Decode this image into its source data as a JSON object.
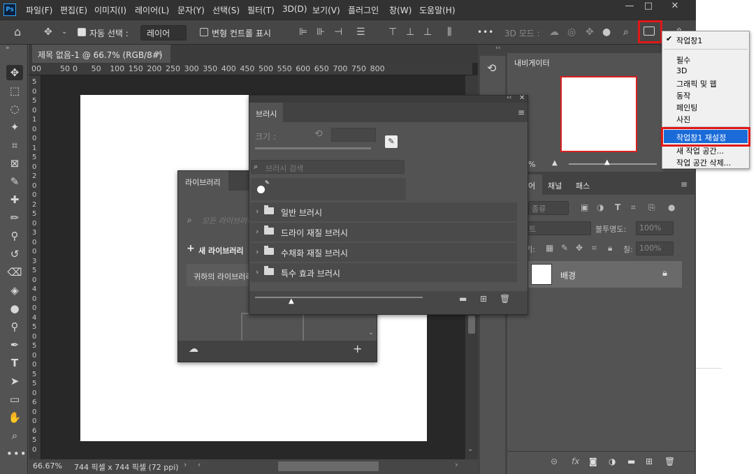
{
  "app": {
    "logo": "Ps"
  },
  "menu": [
    "파일(F)",
    "편집(E)",
    "이미지(I)",
    "레이어(L)",
    "문자(Y)",
    "선택(S)",
    "필터(T)",
    "3D(D)",
    "보기(V)",
    "플러그인",
    "창(W)",
    "도움말(H)"
  ],
  "window_controls": {
    "minimize": "—",
    "maximize": "□",
    "close": "✕"
  },
  "options": {
    "auto_select_label": "자동 선택 :",
    "auto_select_value": "레이어",
    "transform_label": "변형 컨트롤 표시",
    "more": "•••",
    "mode_3d_label": "3D 모드 :"
  },
  "document": {
    "tab_title": "제목 없음-1 @ 66.7% (RGB/8#)",
    "tab_close": "×",
    "zoom": "66.67%",
    "size_info": "744 픽셀 x 744 픽셀 (72 ppi)",
    "ruler_labels": [
      "00",
      "50",
      "0",
      "50",
      "100",
      "150",
      "200",
      "250",
      "300",
      "350",
      "400",
      "450",
      "500",
      "550",
      "600",
      "650",
      "700",
      "750",
      "800"
    ],
    "ruler_v_labels": [
      "5",
      "0",
      "5",
      "0",
      "1",
      "0",
      "0",
      "1",
      "5",
      "0",
      "2",
      "0",
      "0",
      "2",
      "5",
      "0",
      "3",
      "0",
      "0",
      "3",
      "5",
      "0",
      "4",
      "0",
      "0",
      "4",
      "5",
      "0",
      "5",
      "0",
      "0",
      "5",
      "5",
      "0",
      "6",
      "0",
      "0",
      "6",
      "5",
      "0"
    ]
  },
  "brush_panel": {
    "tab": "브러시",
    "size_label": "크기 :",
    "search_placeholder": "브러시 검색",
    "folders": [
      "일반 브러시",
      "드라이 재질 브러시",
      "수채화 재질 브러시",
      "특수 효과 브러시"
    ]
  },
  "library_panel": {
    "tab": "라이브러리",
    "search_placeholder": "모든 라이브러리",
    "new_library": "새 라이브러리",
    "your_library": "귀하의 라이브러리"
  },
  "navigator": {
    "tab": "내비게이터",
    "zoom": "%"
  },
  "layers_panel": {
    "tabs": [
      "어",
      "채널",
      "패스"
    ],
    "kind": "종류",
    "blend": "트",
    "opacity_label": "불투명도:",
    "opacity_value": "100%",
    "lock_label": "기:",
    "fill_label": "칠:",
    "fill_value": "100%",
    "layer_name": "배경"
  },
  "workspace_menu": {
    "current": "작업창1",
    "items": [
      "필수",
      "3D",
      "그래픽 및 웹",
      "동작",
      "페인팅",
      "사진"
    ],
    "reset": "작업창1 재설정",
    "new_ws": "새 작업 공간...",
    "delete_ws": "작업 공간 삭제..."
  },
  "colors": {
    "highlight": "#e01818",
    "selection_blue": "#1a6bd8",
    "ps_blue": "#31a8ff"
  }
}
